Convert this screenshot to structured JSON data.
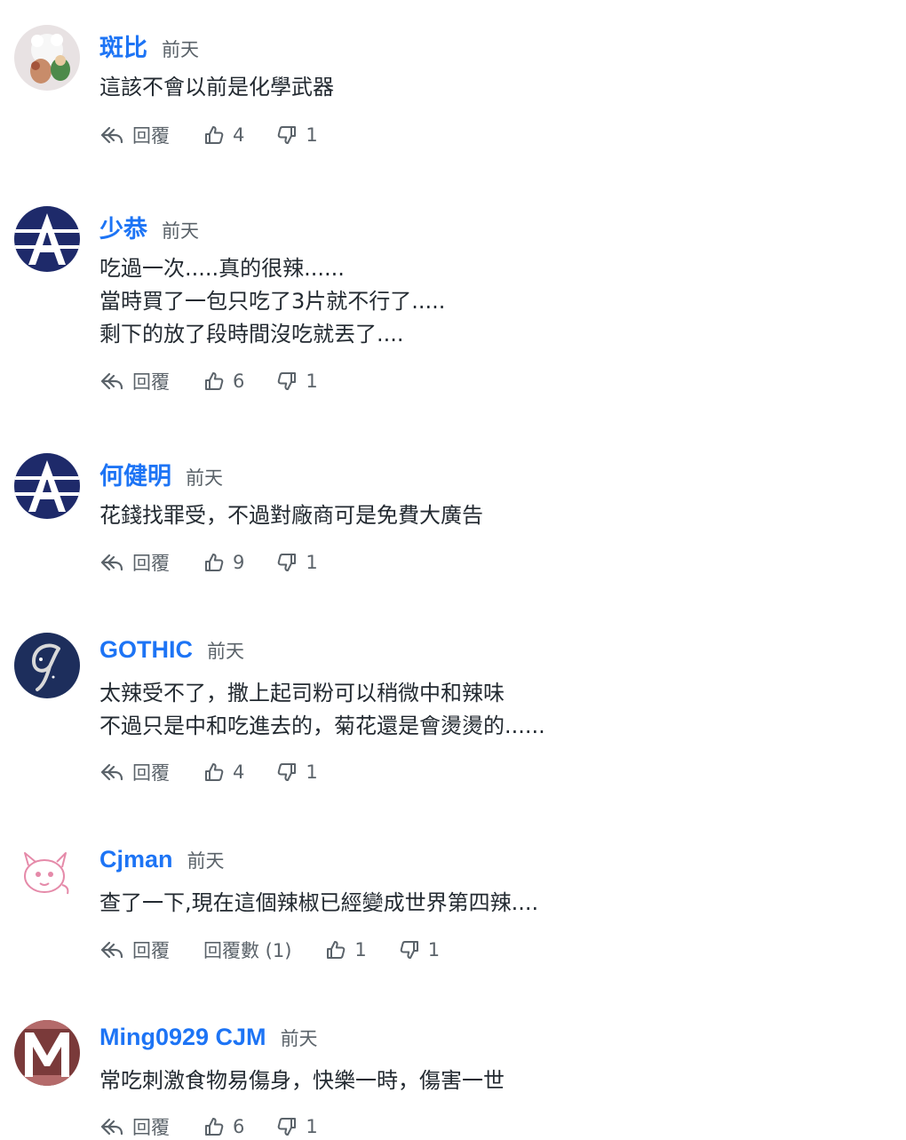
{
  "labels": {
    "reply": "回覆",
    "time": "前天"
  },
  "comments": [
    {
      "name": "斑比",
      "time": "前天",
      "lines": [
        "這該不會以前是化學武器"
      ],
      "reply": "回覆",
      "likes": "4",
      "dislikes": "1",
      "avatar": "photo-avatar"
    },
    {
      "name": "少恭",
      "time": "前天",
      "lines": [
        "吃過一次.....真的很辣......",
        "當時買了一包只吃了3片就不行了.....",
        "剩下的放了段時間沒吃就丟了...."
      ],
      "reply": "回覆",
      "likes": "6",
      "dislikes": "1",
      "avatar": "letter-a-avatar"
    },
    {
      "name": "何健明",
      "time": "前天",
      "lines": [
        "花錢找罪受，不過對廠商可是免費大廣告"
      ],
      "reply": "回覆",
      "likes": "9",
      "dislikes": "1",
      "avatar": "letter-a-avatar"
    },
    {
      "name": "GOTHIC",
      "time": "前天",
      "lines": [
        "太辣受不了，撒上起司粉可以稍微中和辣味",
        "不過只是中和吃進去的，菊花還是會燙燙的......"
      ],
      "reply": "回覆",
      "likes": "4",
      "dislikes": "1",
      "avatar": "letter-g-avatar"
    },
    {
      "name": "Cjman",
      "time": "前天",
      "lines": [
        "查了一下,現在這個辣椒已經變成世界第四辣...."
      ],
      "reply": "回覆",
      "replies_count": "回覆數 (1)",
      "likes": "1",
      "dislikes": "1",
      "avatar": "cartoon-avatar"
    },
    {
      "name": "Ming0929 CJM",
      "time": "前天",
      "lines": [
        "常吃刺激食物易傷身，快樂一時，傷害一世"
      ],
      "reply": "回覆",
      "likes": "6",
      "dislikes": "1",
      "avatar": "letter-m-avatar"
    }
  ]
}
